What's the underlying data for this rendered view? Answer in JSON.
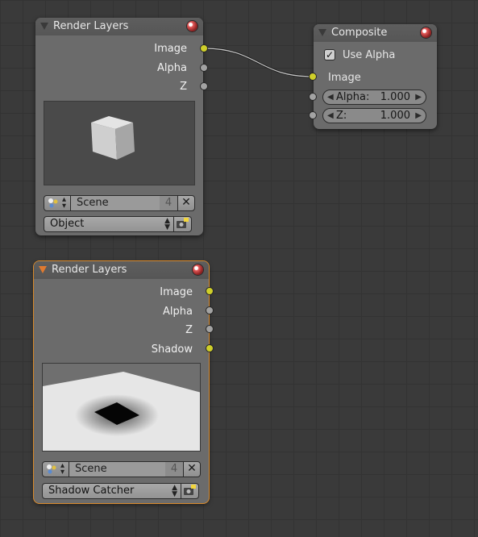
{
  "nodes": {
    "render_layers_1": {
      "title": "Render Layers",
      "outputs": [
        "Image",
        "Alpha",
        "Z"
      ],
      "scene_name": "Scene",
      "scene_users": "4",
      "layer": "Object"
    },
    "composite": {
      "title": "Composite",
      "use_alpha_label": "Use Alpha",
      "use_alpha_checked": true,
      "input_image": "Image",
      "alpha_label": "Alpha:",
      "alpha_value": "1.000",
      "z_label": "Z:",
      "z_value": "1.000"
    },
    "render_layers_2": {
      "title": "Render Layers",
      "outputs": [
        "Image",
        "Alpha",
        "Z",
        "Shadow"
      ],
      "scene_name": "Scene",
      "scene_users": "4",
      "layer": "Shadow Catcher"
    }
  },
  "colors": {
    "socket_color": "#cfcf2a",
    "value_socket": "#a3a3a3",
    "selected_outline": "#d98a2b",
    "node_body": "#6b6b6b",
    "editor_bg": "#3a3a3a"
  },
  "icons": {
    "collapse": "triangle-down-icon",
    "preview": "material-ball-icon",
    "scene": "scene-icon",
    "unlink": "x-icon",
    "camera": "render-camera-icon",
    "checkbox": "checkmark-icon"
  }
}
